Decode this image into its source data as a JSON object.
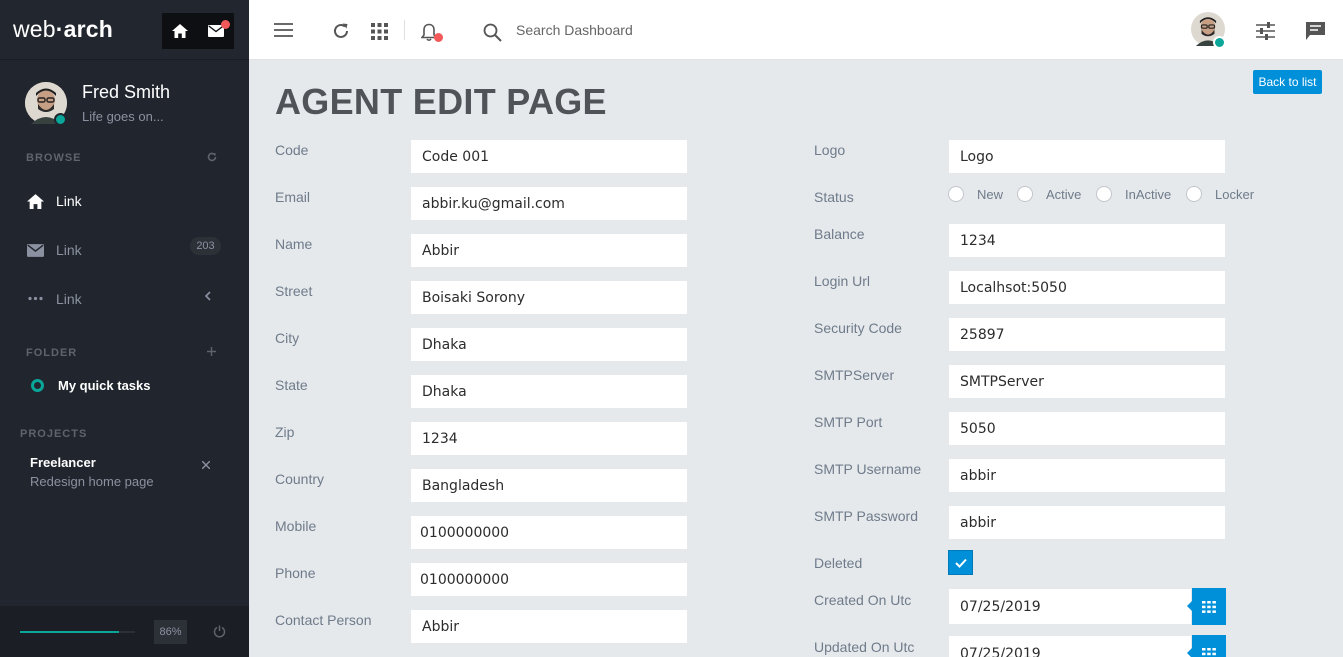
{
  "brand": {
    "text_light": "web",
    "dot": "·",
    "text_bold": "arch"
  },
  "colors": {
    "sidebar": "#21252d",
    "accent": "#0090d9",
    "online": "#0aa699",
    "notify": "#f35958"
  },
  "user": {
    "name": "Fred Smith",
    "status": "Life goes on..."
  },
  "sidebar": {
    "browse_title": "BROWSE",
    "nav": [
      {
        "label": "Link",
        "icon": "home-icon",
        "active": true
      },
      {
        "label": "Link",
        "icon": "mail-icon",
        "badge": "203"
      },
      {
        "label": "Link",
        "icon": "more-icon"
      }
    ],
    "folder_title": "FOLDER",
    "folder_item": "My quick tasks",
    "projects_title": "PROJECTS",
    "project": {
      "name": "Freelancer",
      "task": "Redesign home page"
    },
    "progress": {
      "value": 0.86,
      "label": "86%"
    }
  },
  "header": {
    "search_placeholder": "Search Dashboard"
  },
  "page": {
    "title": "AGENT EDIT PAGE",
    "back_button": "Back to list"
  },
  "left_fields": [
    {
      "label": "Code",
      "value": "Code 001"
    },
    {
      "label": "Email",
      "value": "abbir.ku@gmail.com"
    },
    {
      "label": "Name",
      "value": "Abbir"
    },
    {
      "label": "Street",
      "value": "Boisaki Sorony"
    },
    {
      "label": "City",
      "value": "Dhaka"
    },
    {
      "label": "State",
      "value": "Dhaka"
    },
    {
      "label": "Zip",
      "value": "1234"
    },
    {
      "label": "Country",
      "value": "Bangladesh"
    },
    {
      "label": "Mobile",
      "value": "0100000000"
    },
    {
      "label": "Phone",
      "value": "0100000000"
    },
    {
      "label": "Contact Person",
      "value": "Abbir"
    }
  ],
  "right": {
    "logo": {
      "label": "Logo",
      "value": "Logo"
    },
    "status": {
      "label": "Status",
      "options": [
        "New",
        "Active",
        "InActive",
        "Locker"
      ]
    },
    "balance": {
      "label": "Balance",
      "value": "1234"
    },
    "login_url": {
      "label": "Login Url",
      "value": "Localhsot:5050"
    },
    "security_code": {
      "label": "Security Code",
      "value": "25897"
    },
    "smtp_server": {
      "label": "SMTPServer",
      "value": "SMTPServer"
    },
    "smtp_port": {
      "label": "SMTP Port",
      "value": "5050"
    },
    "smtp_username": {
      "label": "SMTP Username",
      "value": "abbir"
    },
    "smtp_password": {
      "label": "SMTP Password",
      "value": "abbir"
    },
    "deleted": {
      "label": "Deleted",
      "checked": true
    },
    "created_on": {
      "label": "Created On Utc",
      "value": "07/25/2019"
    },
    "updated_on": {
      "label": "Updated On Utc",
      "value": "07/25/2019"
    }
  }
}
